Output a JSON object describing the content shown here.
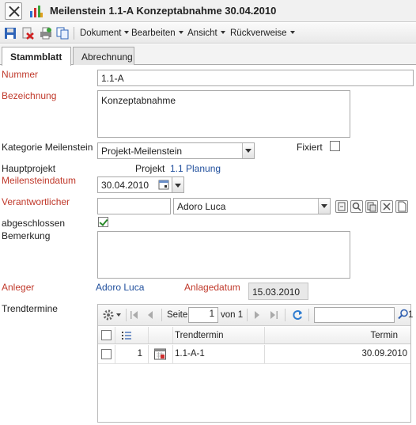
{
  "window": {
    "title": "Meilenstein 1.1-A Konzeptabnahme 30.04.2010"
  },
  "toolbar": {
    "icons": [
      "save-icon",
      "delete-icon",
      "print-icon",
      "copy-icon"
    ],
    "menus": [
      "Dokument",
      "Bearbeiten",
      "Ansicht",
      "Rückverweise"
    ]
  },
  "tabs": [
    {
      "label": "Stammblatt",
      "active": true
    },
    {
      "label": "Abrechnung",
      "active": false
    }
  ],
  "form": {
    "nummer": {
      "label": "Nummer",
      "value": "1.1-A"
    },
    "bezeichnung": {
      "label": "Bezeichnung",
      "value": "Konzeptabnahme"
    },
    "kategorie": {
      "label": "Kategorie Meilenstein",
      "value": "Projekt-Meilenstein"
    },
    "fixiert": {
      "label": "Fixiert",
      "checked": false
    },
    "hauptprojekt": {
      "label": "Hauptprojekt",
      "prefix": "Projekt",
      "value": "1.1 Planung"
    },
    "datum": {
      "label": "Meilensteindatum",
      "value": "30.04.2010"
    },
    "verantwortlicher": {
      "label": "Verantwortlicher",
      "code": "",
      "value": "Adoro Luca"
    },
    "abgeschlossen": {
      "label": "abgeschlossen",
      "checked": true
    },
    "bemerkung": {
      "label": "Bemerkung",
      "value": ""
    },
    "anleger": {
      "label": "Anleger",
      "value": "Adoro Luca"
    },
    "anlagedatum": {
      "label": "Anlagedatum",
      "value": "15.03.2010"
    },
    "trendtermine": {
      "label": "Trendtermine"
    }
  },
  "grid": {
    "pager": {
      "page_label": "Seite",
      "page": "1",
      "of_label": "von 1"
    },
    "search_placeholder": "",
    "search_counter": "1",
    "columns": [
      "Trendtermin",
      "Termin"
    ],
    "rows": [
      {
        "index": "1",
        "trendtermin": "1.1-A-1",
        "termin": "30.09.2010"
      }
    ]
  },
  "colors": {
    "required_label": "#c0392b",
    "link": "#1f4e9c"
  }
}
